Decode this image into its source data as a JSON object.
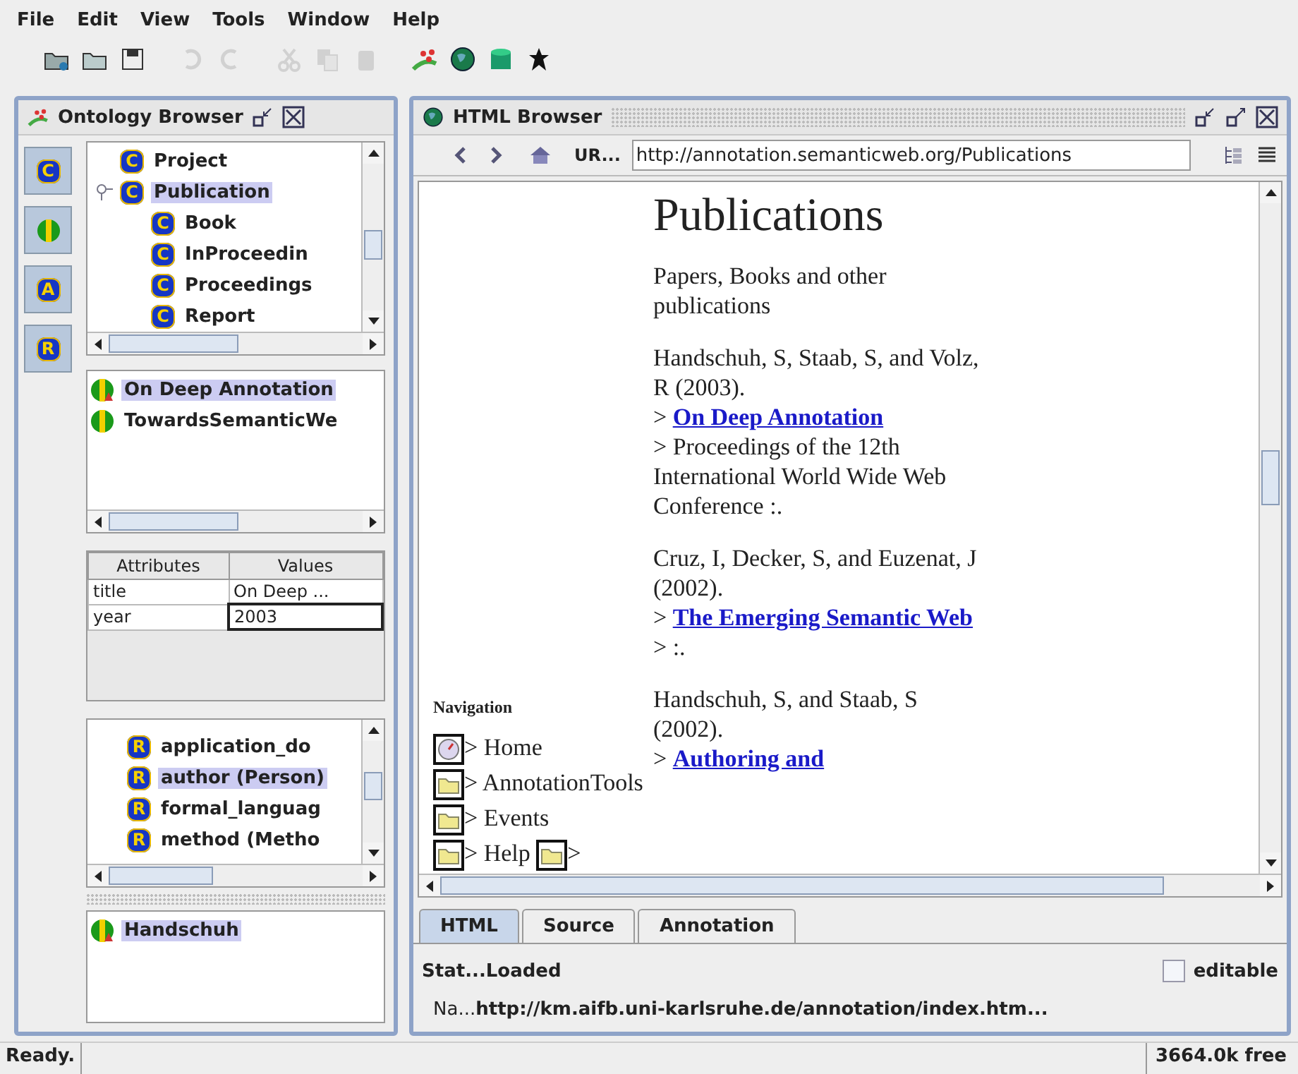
{
  "menu": [
    "File",
    "Edit",
    "View",
    "Tools",
    "Window",
    "Help"
  ],
  "toolbar": [
    {
      "disabled": false
    },
    {
      "disabled": false
    },
    {
      "disabled": false
    },
    {
      "disabled": true
    },
    {
      "disabled": true
    },
    {
      "disabled": true
    },
    {
      "disabled": true
    },
    {
      "disabled": true
    },
    {
      "disabled": false
    },
    {
      "disabled": false
    },
    {
      "disabled": false
    },
    {
      "disabled": false
    }
  ],
  "ontology_browser": {
    "title": "Ontology Browser",
    "tool_buttons": [
      {
        "kind": "badge",
        "badge": "C"
      },
      {
        "kind": "instance"
      },
      {
        "kind": "badge",
        "badge": "A"
      },
      {
        "kind": "badge",
        "badge": "R"
      }
    ],
    "class_tree": [
      {
        "label": "Project",
        "badge": "C",
        "selected": false
      },
      {
        "label": "Publication",
        "badge": "C",
        "selected": true,
        "children": [
          {
            "label": "Book",
            "badge": "C",
            "selected": false
          },
          {
            "label": "InProceedin",
            "badge": "C",
            "selected": false
          },
          {
            "label": "Proceedings",
            "badge": "C",
            "selected": false
          },
          {
            "label": "Report",
            "badge": "C",
            "selected": false
          }
        ]
      }
    ],
    "instances": [
      {
        "label": "On Deep Annotation",
        "selected": true,
        "marked": true
      },
      {
        "label": "TowardsSemanticWe",
        "selected": false,
        "marked": false
      }
    ],
    "attributes": {
      "columns": [
        "Attributes",
        "Values"
      ],
      "rows": [
        {
          "attribute": "title",
          "value": "On Deep ...",
          "editing": false
        },
        {
          "attribute": "year",
          "value": "2003",
          "editing": true
        }
      ]
    },
    "properties": [
      {
        "label": "application_do",
        "badge": "R",
        "selected": false
      },
      {
        "label": "author (Person)",
        "badge": "R",
        "selected": true
      },
      {
        "label": "formal_languag",
        "badge": "R",
        "selected": false
      },
      {
        "label": "method (Metho",
        "badge": "R",
        "selected": false
      }
    ],
    "results": [
      {
        "label": "Handschuh",
        "selected": true,
        "marked": true
      }
    ]
  },
  "html_browser": {
    "title": "HTML Browser",
    "url_label": "UR...",
    "url": "http://annotation.semanticweb.org/Publications",
    "page": {
      "heading": "Publications",
      "intro": "Papers, Books and other publications",
      "nav_title": "Navigation",
      "nav": [
        {
          "kind": "home",
          "text": "> Home"
        },
        {
          "kind": "folder",
          "text": "> AnnotationTools"
        },
        {
          "kind": "folder",
          "text": "> Events"
        },
        {
          "kind": "folder",
          "text": "> Help"
        },
        {
          "kind": "folder",
          "text": ">"
        }
      ],
      "entries": [
        {
          "authors": "Handschuh, S, Staab, S, and Volz, R (2003).",
          "prefix": ">",
          "link": "On Deep Annotation",
          "venue": "> Proceedings of the 12th International World Wide Web Conference :."
        },
        {
          "authors": "Cruz, I, Decker, S, and Euzenat, J (2002).",
          "prefix": ">",
          "link": "The Emerging Semantic Web",
          "venue": "> :."
        },
        {
          "authors": "Handschuh, S, and Staab, S (2002).",
          "prefix": ">",
          "link": "Authoring and"
        }
      ]
    },
    "tabs": [
      {
        "label": "HTML",
        "selected": true
      },
      {
        "label": "Source",
        "selected": false
      },
      {
        "label": "Annotation",
        "selected": false
      }
    ],
    "status_label": "Stat...",
    "status": "Loaded",
    "editable": {
      "label": "editable",
      "checked": false
    },
    "name_label": "Na...",
    "name": "http://km.aifb.uni-karlsruhe.de/annotation/index.htm..."
  },
  "status_bar": {
    "message": "Ready.",
    "memory": "3664.0k free"
  }
}
